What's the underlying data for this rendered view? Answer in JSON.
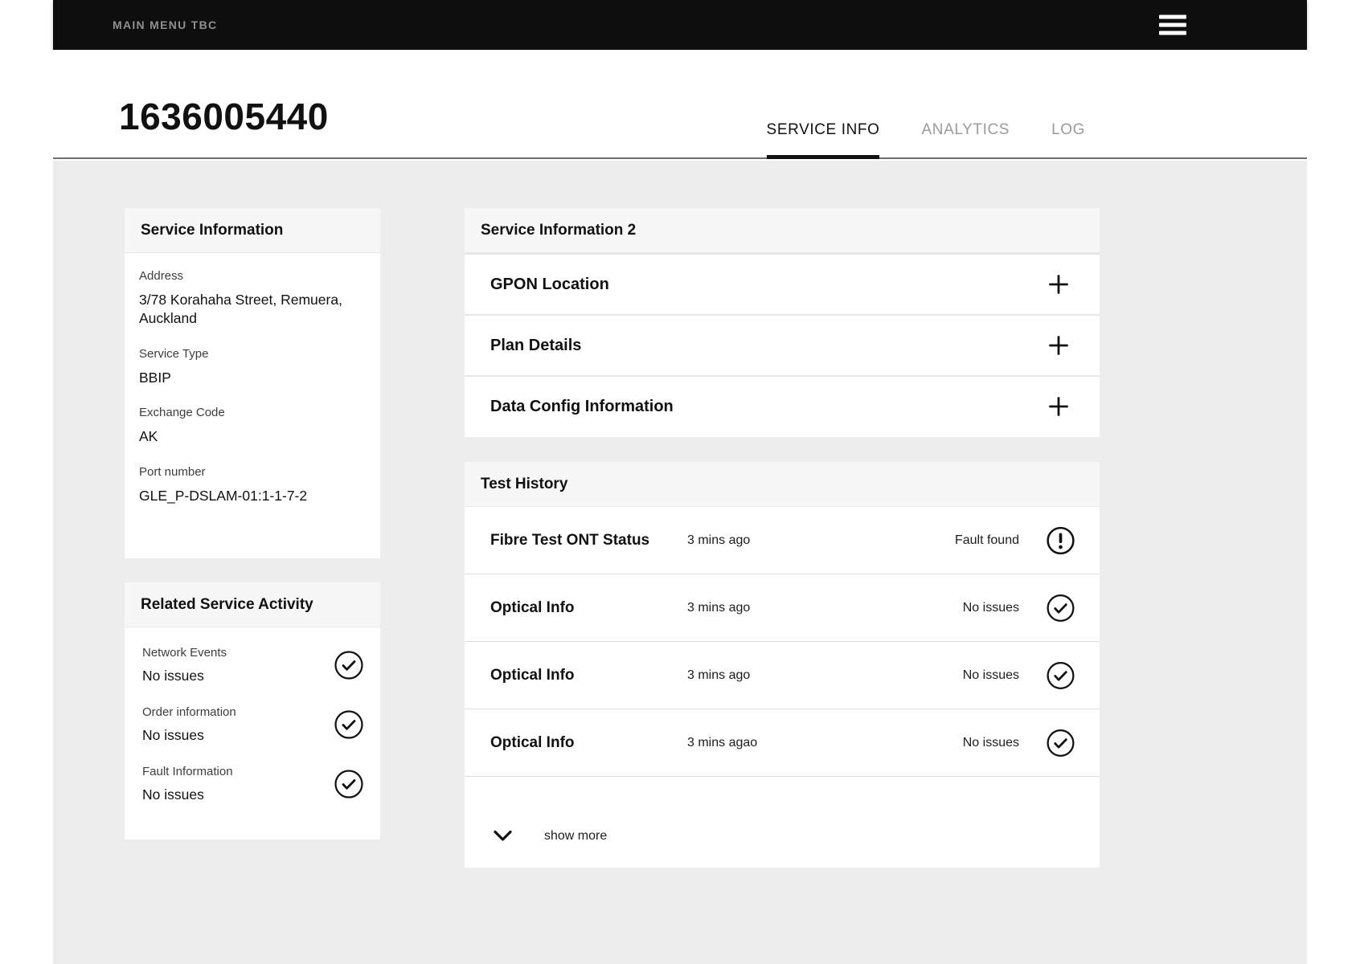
{
  "topbar": {
    "menu_label": "MAIN MENU TBC"
  },
  "header": {
    "title": "1636005440",
    "tabs": [
      {
        "label": "SERVICE INFO",
        "active": true
      },
      {
        "label": "ANALYTICS",
        "active": false
      },
      {
        "label": "LOG",
        "active": false
      }
    ]
  },
  "service_information": {
    "title": "Service Information",
    "fields": [
      {
        "label": "Address",
        "value": "3/78 Korahaha Street, Remuera, Auckland"
      },
      {
        "label": "Service Type",
        "value": "BBIP"
      },
      {
        "label": "Exchange Code",
        "value": "AK"
      },
      {
        "label": "Port number",
        "value": "GLE_P-DSLAM-01:1-1-7-2"
      }
    ]
  },
  "related_service_activity": {
    "title": "Related Service Activity",
    "items": [
      {
        "label": "Network Events",
        "status": "No issues",
        "icon": "check-circle"
      },
      {
        "label": "Order information",
        "status": "No issues",
        "icon": "check-circle"
      },
      {
        "label": "Fault Information",
        "status": "No issues",
        "icon": "check-circle"
      }
    ]
  },
  "service_information_2": {
    "title": "Service Information 2",
    "sections": [
      {
        "label": "GPON Location",
        "toggle_icon": "plus-icon"
      },
      {
        "label": "Plan Details",
        "toggle_icon": "plus-icon"
      },
      {
        "label": "Data Config Information",
        "toggle_icon": "plus-icon"
      }
    ]
  },
  "test_history": {
    "title": "Test History",
    "rows": [
      {
        "name": "Fibre Test ONT Status",
        "time": "3 mins ago",
        "status": "Fault found",
        "icon": "alert-circle"
      },
      {
        "name": "Optical Info",
        "time": "3 mins ago",
        "status": "No issues",
        "icon": "check-circle"
      },
      {
        "name": "Optical Info",
        "time": "3 mins ago",
        "status": "No issues",
        "icon": "check-circle"
      },
      {
        "name": "Optical Info",
        "time": "3 mins agao",
        "status": "No issues",
        "icon": "check-circle"
      }
    ],
    "show_more_label": "show more"
  },
  "colors": {
    "topbar_bg": "#0e0e0e",
    "content_bg": "#ededed",
    "card_header_bg": "#f7f7f7",
    "text": "#111111",
    "muted_text": "#9b9b9b"
  }
}
